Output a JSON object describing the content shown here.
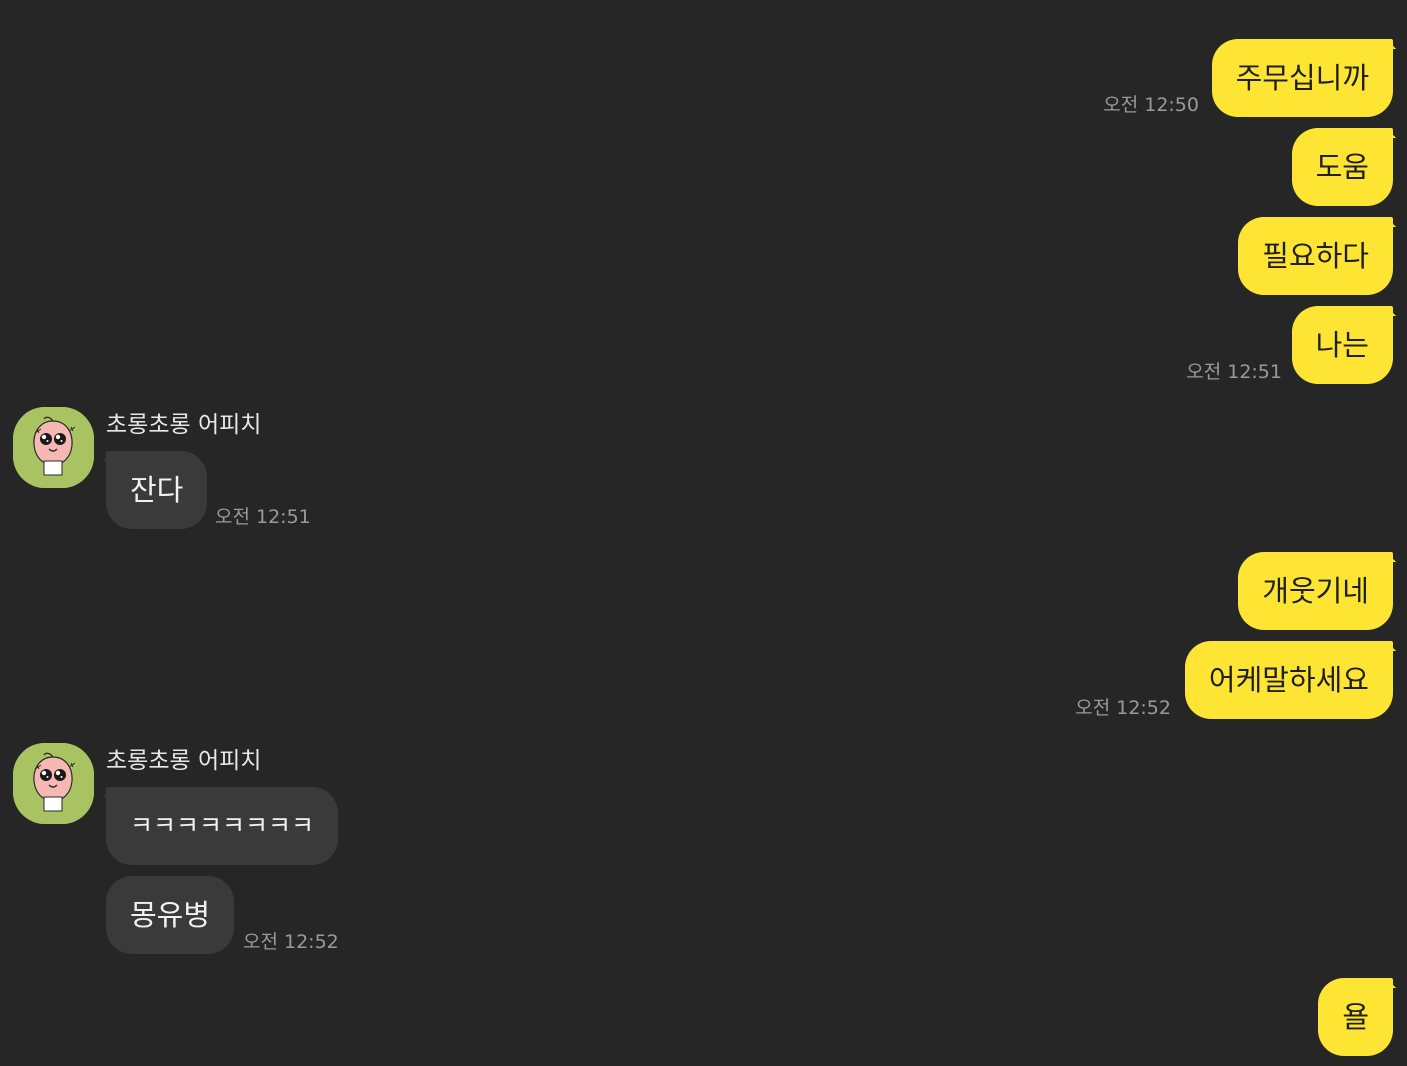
{
  "theme": {
    "background": "#262626",
    "outgoing_bubble": "#fee534",
    "incoming_bubble": "#3a3a3a",
    "avatar_bg": "#a9c262",
    "time_color": "#9a9a9a"
  },
  "messages": [
    {
      "from": "me",
      "text": "주무십니까",
      "time": "오전 12:50"
    },
    {
      "from": "me",
      "text": "도움"
    },
    {
      "from": "me",
      "text": "필요하다"
    },
    {
      "from": "me",
      "text": "나는",
      "time": "오전 12:51"
    },
    {
      "from": "other",
      "sender": "초롱초롱 어피치",
      "avatar": "apeach-avatar-icon",
      "text": "잔다",
      "time": "오전 12:51"
    },
    {
      "from": "me",
      "text": "개웃기네"
    },
    {
      "from": "me",
      "text": "어케말하세요",
      "time": "오전 12:52"
    },
    {
      "from": "other",
      "sender": "초롱초롱 어피치",
      "avatar": "apeach-avatar-icon",
      "text": "ㅋㅋㅋㅋㅋㅋㅋㅋ"
    },
    {
      "from": "other",
      "text": "몽유병",
      "time": "오전 12:52"
    },
    {
      "from": "me",
      "text": "욜"
    }
  ]
}
